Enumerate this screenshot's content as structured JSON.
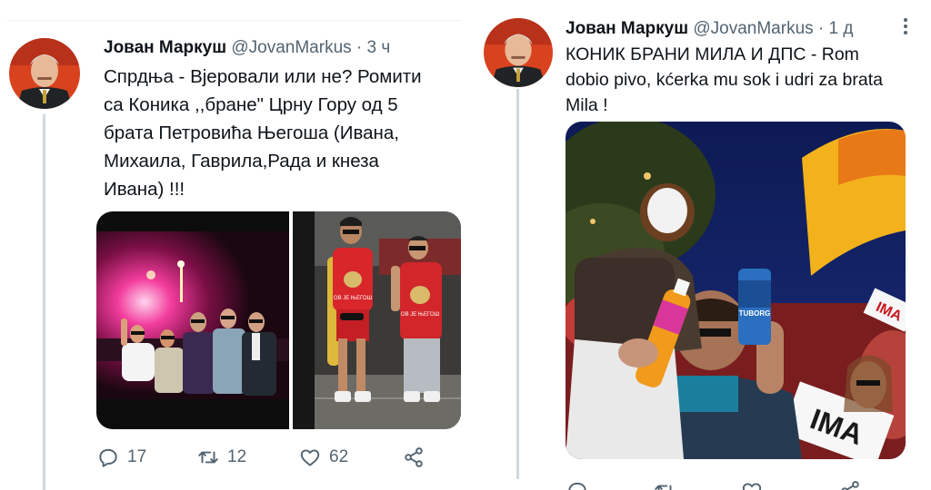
{
  "colors": {
    "text_primary": "#0f1419",
    "text_secondary": "#536471",
    "thread_line": "#cfd9de",
    "divider": "#eff3f4"
  },
  "tweets": [
    {
      "author": {
        "name": "Јован Маркуш",
        "handle": "@JovanMarkus",
        "separator": "·",
        "time": "3 ч"
      },
      "text_lines": [
        "Спрдња - Вјеровали или не? Ромити",
        "са Коника ,,бране\" Црну Гору од 5",
        "брата Петровића Његоша (Ивана,",
        "Михаила, Гаврила,Рада и кнеза",
        "Ивана) !!!"
      ],
      "media": [
        {
          "icon": "photo-crowd-flare"
        },
        {
          "icon": "photo-red-shirts",
          "shirt_text": "ОВ ЈЕ ЊЕГОШ"
        }
      ],
      "actions": {
        "reply_count": "17",
        "retweet_count": "12",
        "like_count": "62"
      }
    },
    {
      "author": {
        "name": "Јован Маркуш",
        "handle": "@JovanMarkus",
        "separator": "·",
        "time": "1 д"
      },
      "text_lines": [
        "КОНИК БРАНИ МИЛА И ДПС - Rom",
        "dobio pivo, kćerka mu sok i udri za brata",
        "Mila !"
      ],
      "media": [
        {
          "icon": "photo-rally-night",
          "sign_text_1": "IMA",
          "sign_text_2": "IMA",
          "can_text": "TUBORG"
        }
      ],
      "actions": {}
    }
  ]
}
